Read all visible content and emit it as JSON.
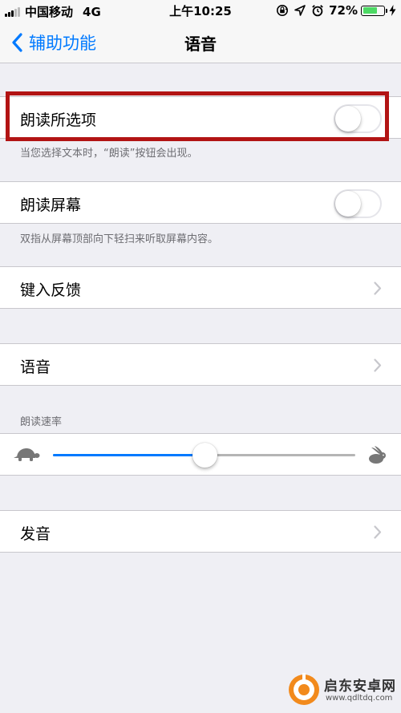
{
  "status_bar": {
    "carrier": "中国移动",
    "network": "4G",
    "time": "上午10:25",
    "battery_percent": "72%",
    "battery_level": 0.72,
    "battery_color": "#4cd964",
    "icons": [
      "signal-icon",
      "rotation-lock-icon",
      "location-icon",
      "alarm-icon",
      "battery-icon",
      "charging-bolt-icon"
    ]
  },
  "nav": {
    "back_label": "辅助功能",
    "title": "语音",
    "back_icon": "chevron-left-icon",
    "accent_color": "#007aff"
  },
  "speak_selection": {
    "label": "朗读所选项",
    "enabled": false,
    "footer": "当您选择文本时，“朗读”按钮会出现。"
  },
  "speak_screen": {
    "label": "朗读屏幕",
    "enabled": false,
    "footer": "双指从屏幕顶部向下轻扫来听取屏幕内容。"
  },
  "typing_feedback": {
    "label": "键入反馈"
  },
  "voices": {
    "label": "语音"
  },
  "speaking_rate": {
    "header": "朗读速率",
    "value": 0.5,
    "min_icon": "turtle-icon",
    "max_icon": "rabbit-icon"
  },
  "pronunciations": {
    "label": "发音"
  },
  "watermark": {
    "name": "启东安卓网",
    "url": "www.qdltdq.com"
  }
}
